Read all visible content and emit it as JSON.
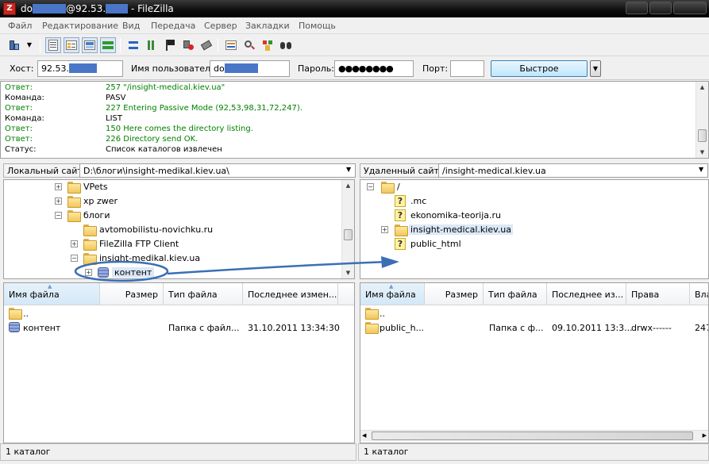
{
  "window": {
    "title_prefix": "do",
    "title_mid": "@92.53.",
    "title_suffix": " - FileZilla",
    "app_icon": "filezilla-icon"
  },
  "menu": [
    "Файл",
    "Редактирование",
    "Вид",
    "Передача",
    "Сервер",
    "Закладки",
    "Помощь"
  ],
  "toolbar_icons": [
    "site-manager-icon",
    "site-manager-dropdown-icon",
    "toggle-message-log-icon",
    "toggle-local-tree-icon",
    "toggle-remote-tree-icon",
    "toggle-transfer-queue-icon",
    "refresh-icon",
    "process-queue-icon",
    "stop-icon",
    "disconnect-icon",
    "reconnect-icon",
    "directory-compare-icon",
    "filter-icon",
    "sync-browsing-icon",
    "search-icon"
  ],
  "quickconnect": {
    "host_label": "Хост:",
    "host_value": "92.53.",
    "user_label": "Имя пользователя",
    "user_value": "do",
    "pass_label": "Пароль:",
    "pass_value": "●●●●●●●●",
    "port_label": "Порт:",
    "port_value": "",
    "button": "Быстрое соединение"
  },
  "log": [
    {
      "key": "Ответ:",
      "value": "257 \"/insight-medical.kiev.ua\"",
      "color": "#008000"
    },
    {
      "key": "Команда:",
      "value": "PASV",
      "color": "#000000"
    },
    {
      "key": "Ответ:",
      "value": "227 Entering Passive Mode (92,53,98,31,72,247).",
      "color": "#008000"
    },
    {
      "key": "Команда:",
      "value": "LIST",
      "color": "#000000"
    },
    {
      "key": "Ответ:",
      "value": "150 Here comes the directory listing.",
      "color": "#008000"
    },
    {
      "key": "Ответ:",
      "value": "226 Directory send OK.",
      "color": "#008000"
    },
    {
      "key": "Статус:",
      "value": "Список каталогов извлечен",
      "color": "#000000"
    }
  ],
  "local": {
    "label": "Локальный сайт:",
    "path": "D:\\блоги\\insight-medikal.kiev.ua\\",
    "tree": [
      {
        "name": "VPets",
        "expander": "+"
      },
      {
        "name": "xp zwer",
        "expander": "+"
      },
      {
        "name": "блоги",
        "expander": "−"
      },
      {
        "name": "avtomobilistu-novichku.ru",
        "expander": ""
      },
      {
        "name": "FileZilla FTP Client",
        "expander": "+"
      },
      {
        "name": "insight-medikal.kiev.ua",
        "expander": "−"
      },
      {
        "name": "контент",
        "expander": "+"
      }
    ],
    "columns": [
      "Имя файла",
      "Размер",
      "Тип файла",
      "Последнее измен..."
    ],
    "files": [
      {
        "name": "..",
        "size": "",
        "type": "",
        "modified": ""
      },
      {
        "name": "контент",
        "size": "",
        "type": "Папка с файл...",
        "modified": "31.10.2011 13:34:30"
      }
    ],
    "status": "1 каталог"
  },
  "remote": {
    "label": "Удаленный сайт:",
    "path": "/insight-medical.kiev.ua",
    "tree": [
      {
        "name": "/",
        "expander": "−"
      },
      {
        "name": ".mc",
        "expander": ""
      },
      {
        "name": "ekonomika-teorija.ru",
        "expander": ""
      },
      {
        "name": "insight-medical.kiev.ua",
        "expander": "+"
      },
      {
        "name": "public_html",
        "expander": ""
      }
    ],
    "columns": [
      "Имя файла",
      "Размер",
      "Тип файла",
      "Последнее из...",
      "Права",
      "Вла"
    ],
    "files": [
      {
        "name": "..",
        "size": "",
        "type": "",
        "modified": "",
        "perms": "",
        "owner": ""
      },
      {
        "name": "public_h...",
        "size": "",
        "type": "Папка с ф...",
        "modified": "09.10.2011 13:3...",
        "perms": "drwx------",
        "owner": "247"
      }
    ],
    "status": "1 каталог"
  },
  "colors": {
    "response": "#008000",
    "annotation": "#3a6fb5",
    "selection": "#dbe8f7"
  }
}
